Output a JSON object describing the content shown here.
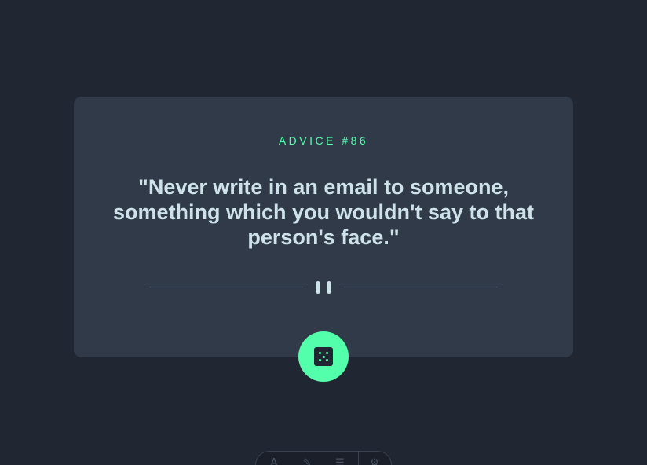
{
  "card": {
    "advice_id": "ADVICE #86",
    "advice_text": "\"Never write in an email to someone, something which you wouldn't say to that person's face.\""
  },
  "divider": {
    "icon": "pause-icon"
  },
  "dice_button": {
    "icon": "dice-icon"
  },
  "toolbar": {
    "icons": [
      "text-icon",
      "brush-icon",
      "menu-icon",
      "settings-icon"
    ]
  },
  "colors": {
    "background": "#202632",
    "card": "#313a49",
    "accent": "#53ffaa",
    "text": "#cee3e9"
  }
}
